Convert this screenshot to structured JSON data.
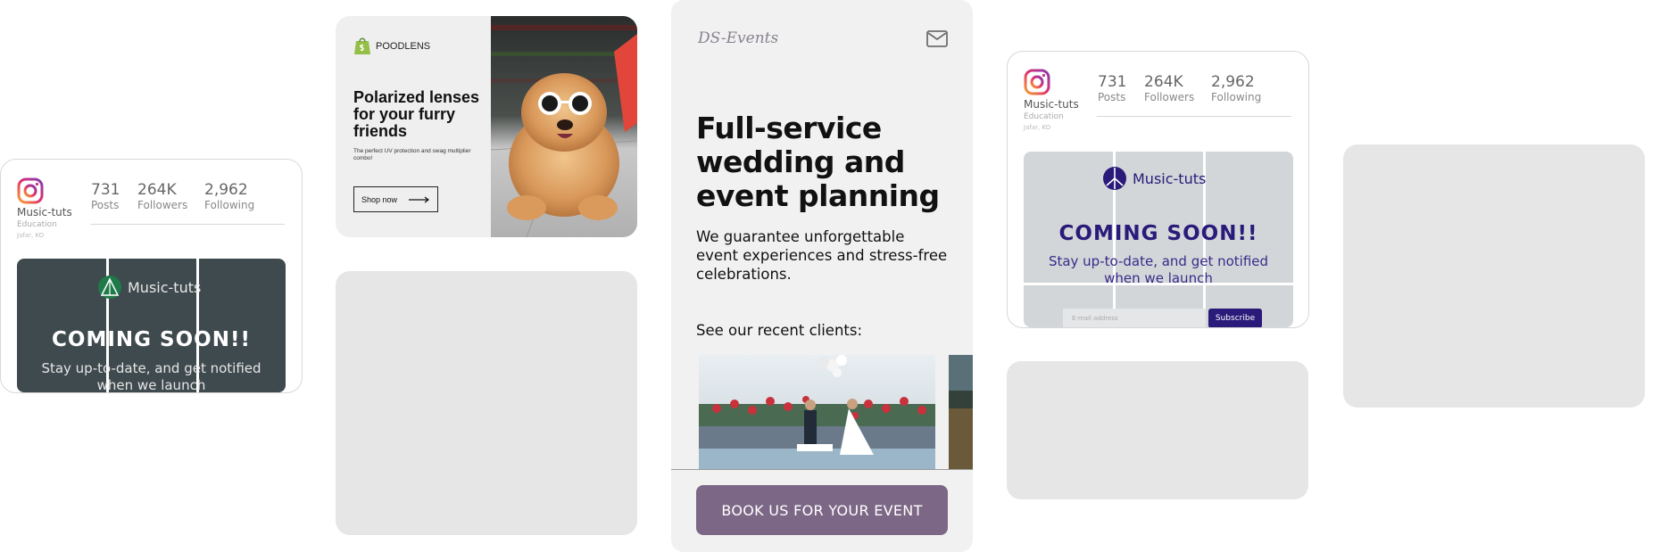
{
  "ig_left": {
    "name": "Music-tuts",
    "category": "Education",
    "location": "Jafar, KO",
    "stats": [
      {
        "value": "731",
        "label": "Posts"
      },
      {
        "value": "264K",
        "label": "Followers"
      },
      {
        "value": "2,962",
        "label": "Following"
      }
    ],
    "post": {
      "brand": "Music-tuts",
      "title": "COMING SOON!!",
      "subtitle": "Stay up-to-date, and get notified when we launch",
      "bg_color": "#3f4a4e",
      "accent": "#1f7a4a"
    }
  },
  "shop_ad": {
    "brand": "POODLENS",
    "headline": "Polarized lenses for your furry friends",
    "body": "The perfect UV protection and swag multiplier combo!",
    "cta": "Shop now",
    "brand_color": "#95bf47"
  },
  "event": {
    "logo": "DS-Events",
    "headline": "Full-service wedding and event planning",
    "body": "We guarantee unforgettable event experiences and stress-free celebrations.",
    "clients_label": "See our recent clients:",
    "cta": "BOOK US FOR YOUR EVENT",
    "cta_color": "#7d6786"
  },
  "ig_right": {
    "name": "Music-tuts",
    "category": "Education",
    "location": "Jafar, KO",
    "stats": [
      {
        "value": "731",
        "label": "Posts"
      },
      {
        "value": "264K",
        "label": "Followers"
      },
      {
        "value": "2,962",
        "label": "Following"
      }
    ],
    "post": {
      "brand": "Music-tuts",
      "title": "COMING SOON!!",
      "subtitle": "Stay up-to-date, and get notified when we launch",
      "email_placeholder": "E-mail address",
      "subscribe": "Subscribe",
      "bg_color": "#d2d6d8",
      "accent": "#2a1a7a"
    }
  }
}
